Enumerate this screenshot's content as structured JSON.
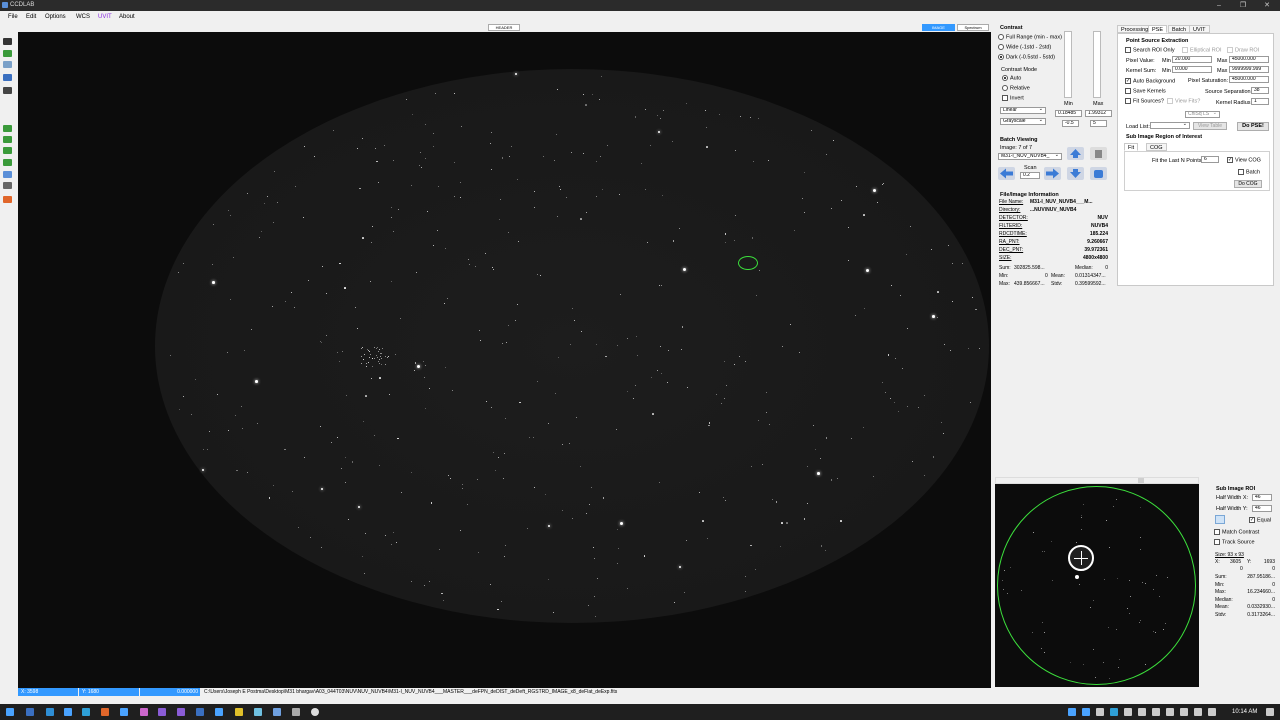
{
  "app": {
    "title": "CCDLAB"
  },
  "menu": [
    "File",
    "Edit",
    "Options",
    "WCS",
    "UVIT",
    "About"
  ],
  "viewer_buttons": {
    "header": "HEADER",
    "image": "IMAGE",
    "spectrum": "Spectrum"
  },
  "contrast": {
    "title": "Contrast",
    "options": [
      "Full Range (min - max)",
      "Wide (-1std - 2std)",
      "Dark (-0.5std - 5std)"
    ],
    "selected": "Dark (-0.5std - 5std)",
    "mode_title": "Contrast Mode",
    "modes": [
      "Auto",
      "Relative"
    ],
    "mode_selected": "Auto",
    "invert": "Invert",
    "scale": "Linear",
    "colormap": "Grayscale",
    "min_label": "Min",
    "max_label": "Max",
    "min_value": "0.18485",
    "max_value": "1.99312",
    "min_std": "-0.5",
    "max_std": "5"
  },
  "batch": {
    "title": "Batch Viewing",
    "image_count": "Image: 7 of 7",
    "file": "M31-I_NUV_NUVB4_",
    "scan_label": "Scan",
    "scan_value": "0.2"
  },
  "fileinfo": {
    "title": "File/Image Information",
    "rows": [
      {
        "k": "File Name:",
        "v": "M31-I_NUV_NUVB4___M..."
      },
      {
        "k": "Directory:",
        "v": "...NUV\\NUV_NUVB4"
      },
      {
        "k": "DETECTOR:",
        "v": "NUV"
      },
      {
        "k": "FILTERID:",
        "v": "NUVB4"
      },
      {
        "k": "RDCDTIME:",
        "v": "185.224"
      },
      {
        "k": "RA_PNT:",
        "v": "9.260667"
      },
      {
        "k": "DEC_PNT:",
        "v": "39.972361"
      },
      {
        "k": "SIZE:",
        "v": "4800x4800"
      }
    ],
    "stats": {
      "sum_label": "Sum:",
      "sum": "302825.598...",
      "median_label": "Median:",
      "median": "0",
      "min_label": "Min:",
      "min": "0",
      "mean_label": "Mean:",
      "mean": "0.01314347...",
      "max_label": "Max:",
      "max": "439.856667...",
      "stdv_label": "Stdv:",
      "stdv": "0.39599592..."
    }
  },
  "right_tabs": [
    "Processing",
    "PSE",
    "Batch",
    "UVIT"
  ],
  "pse": {
    "title": "Point Source Extraction",
    "search_roi": "Search ROI Only",
    "elliptical_roi": "Elliptical ROI",
    "draw_roi": "Draw ROI",
    "pixel_value": "Pixel Value:",
    "kernel_sum": "Kernel Sum:",
    "min_label": "Min",
    "max_label": "Max",
    "pv_min": "20.000",
    "pv_max": "45000.000",
    "ks_min": "0.000",
    "ks_max": "9999999.999",
    "auto_background": "Auto Background",
    "pixel_saturation": "Pixel Saturation:",
    "saturation_value": "45000.000",
    "save_kernels": "Save Kernels",
    "source_separation": "Source Separation:",
    "separation_value": "38",
    "fit_sources": "Fit Sources?",
    "view_fits": "View Fits?",
    "kernel_radius": "Kernel Radius:",
    "radius_value": "1",
    "fit_method": "ChiSq LS",
    "load_list": "Load List:",
    "view_table": "View Table",
    "do_pse": "Do PSE!"
  },
  "subimage_roi_panel": {
    "title": "Sub Image Region of Interest",
    "tabs": [
      "Fit",
      "COG"
    ],
    "fit_last": "Fit the Last N Points:",
    "fit_n": "6",
    "view_cog": "View COG",
    "batch": "Batch",
    "do_cog": "Do COG"
  },
  "subroi": {
    "title": "Sub Image ROI",
    "half_width_x": "Half Width X:",
    "hwx": "46",
    "half_width_y": "Half Width Y:",
    "hwy": "46",
    "equal": "Equal",
    "match_contrast": "Match Contrast",
    "track_source": "Track Source",
    "size": "Size: 93 x 93",
    "x_label": "X:",
    "x": "3605",
    "y_label": "Y:",
    "y": "1693",
    "x2": "0",
    "y2": "0",
    "stats": [
      {
        "k": "Sum:",
        "v": "287.95186..."
      },
      {
        "k": "Min:",
        "v": "0"
      },
      {
        "k": "Max:",
        "v": "16.234660..."
      },
      {
        "k": "Median:",
        "v": "0"
      },
      {
        "k": "Mean:",
        "v": "0.0332930..."
      },
      {
        "k": "Stdv:",
        "v": "0.3173264..."
      }
    ]
  },
  "status": {
    "x": "X:  3598",
    "y": "Y:  1680",
    "value": "0.000000",
    "path": "C:\\Users\\Joseph E Postma\\Desktop\\M31 bhargav\\A03_044T03\\NUV\\NUV_NUVB4\\M31-I_NUV_NUVB4___MASTER___deFPN_deDIST_deDeft_RGSTRD_IMAGE_x8_deFlat_deExp.fits"
  },
  "taskbar": {
    "time": "10:14 AM"
  },
  "colors": {
    "accent": "#3399ff",
    "roi_green": "#3ce03c",
    "viewer_bg": "#0c0c0c"
  }
}
